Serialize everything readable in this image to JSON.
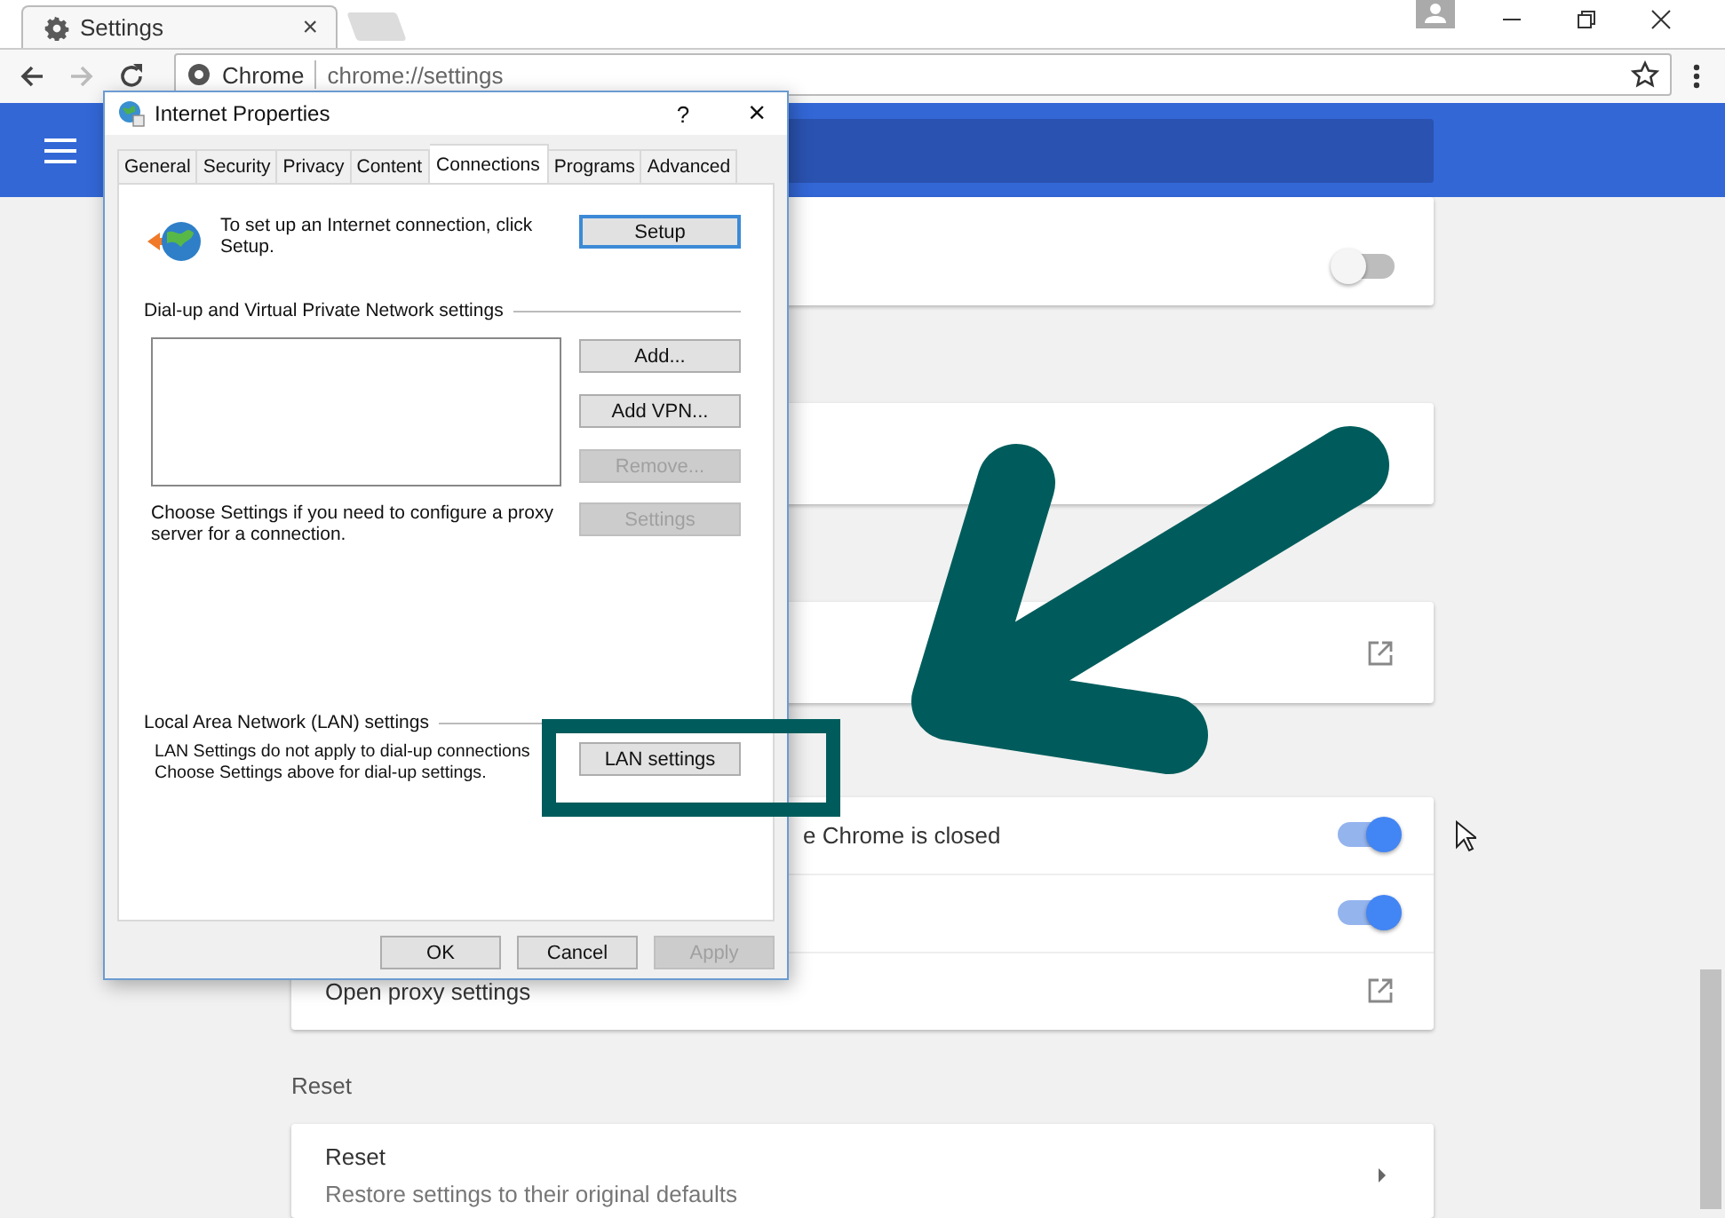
{
  "browser": {
    "tab": {
      "title": "Settings",
      "close": "×"
    },
    "address": {
      "site": "Chrome",
      "url": "chrome://settings"
    }
  },
  "settings": {
    "cards": [
      {
        "rows": [
          {
            "kind": "toggle",
            "label": "",
            "on": false
          }
        ]
      },
      {
        "kind": "blank"
      },
      {
        "rows": [
          {
            "kind": "link",
            "label": ""
          }
        ]
      },
      {
        "rows": [
          {
            "kind": "toggle",
            "label": "e Chrome is closed",
            "on": true
          },
          {
            "kind": "toggle",
            "label": "",
            "on": true
          },
          {
            "kind": "link",
            "label": "Open proxy settings"
          }
        ]
      }
    ],
    "reset": {
      "heading": "Reset",
      "title": "Reset",
      "subtitle": "Restore settings to their original defaults"
    }
  },
  "dialog": {
    "title": "Internet Properties",
    "help": "?",
    "close": "×",
    "tabs": [
      {
        "label": "General",
        "selected": false
      },
      {
        "label": "Security",
        "selected": false
      },
      {
        "label": "Privacy",
        "selected": false
      },
      {
        "label": "Content",
        "selected": false
      },
      {
        "label": "Connections",
        "selected": true
      },
      {
        "label": "Programs",
        "selected": false
      },
      {
        "label": "Advanced",
        "selected": false
      }
    ],
    "setup_text": "To set up an Internet connection, click Setup.",
    "setup_button": "Setup",
    "dialup_heading": "Dial-up and Virtual Private Network settings",
    "dialup_buttons": [
      {
        "label": "Add...",
        "disabled": false
      },
      {
        "label": "Add VPN...",
        "disabled": false
      },
      {
        "label": "Remove...",
        "disabled": true
      }
    ],
    "proxy_text": "Choose Settings if you need to configure a proxy server for a connection.",
    "proxy_button": {
      "label": "Settings",
      "disabled": true
    },
    "lan_heading": "Local Area Network (LAN) settings",
    "lan_text": [
      "LAN Settings do not apply to dial-up connections",
      "Choose Settings above for dial-up settings."
    ],
    "lan_button": "LAN settings",
    "footer_buttons": [
      {
        "label": "OK",
        "disabled": false
      },
      {
        "label": "Cancel",
        "disabled": false
      },
      {
        "label": "Apply",
        "disabled": true
      }
    ]
  }
}
